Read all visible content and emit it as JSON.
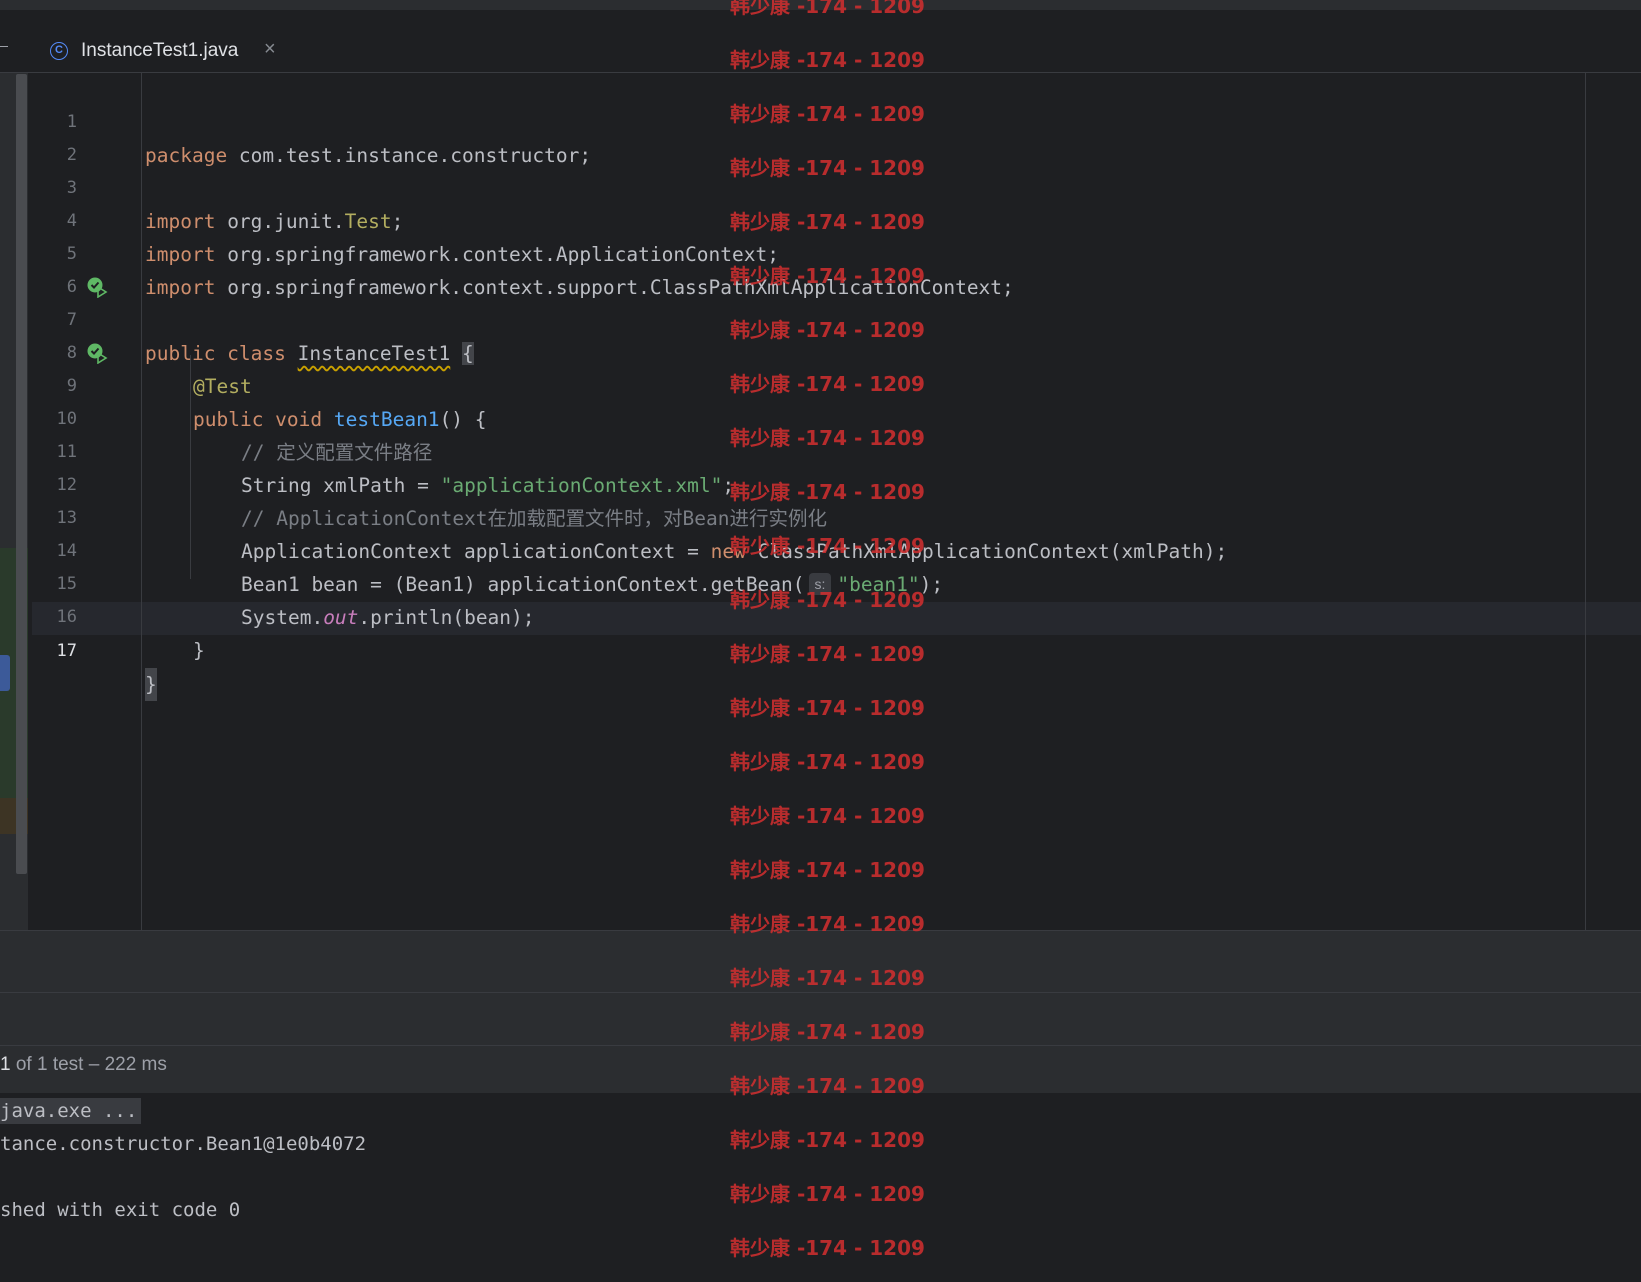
{
  "tab": {
    "icon": "java-class-icon",
    "icon_glyph": "C",
    "title": "InstanceTest1.java",
    "close_glyph": "×"
  },
  "editor": {
    "line_numbers": [
      "1",
      "2",
      "3",
      "4",
      "5",
      "6",
      "7",
      "8",
      "9",
      "10",
      "11",
      "12",
      "13",
      "14",
      "15",
      "16",
      "17"
    ],
    "current_line": "17",
    "code": {
      "l1": {
        "kw": "package",
        "rest": " com.test.instance.constructor;"
      },
      "l3": {
        "kw": "import",
        "pre": " org.junit.",
        "ann": "Test",
        "post": ";"
      },
      "l4": {
        "kw": "import",
        "rest": " org.springframework.context.ApplicationContext;"
      },
      "l5": {
        "kw": "import",
        "rest": " org.springframework.context.support.ClassPathXmlApplicationContext;"
      },
      "l7": {
        "kw": "public class",
        "name": "InstanceTest1",
        "brace": "{"
      },
      "l8": {
        "ann": "@Test"
      },
      "l9": {
        "kw": "public void",
        "fn": "testBean1",
        "rest": "() {"
      },
      "l10": {
        "cmt": "// 定义配置文件路径"
      },
      "l11": {
        "pre": "String xmlPath = ",
        "str": "\"applicationContext.xml\"",
        "post": ";"
      },
      "l12": {
        "cmt": "// ApplicationContext在加载配置文件时，对Bean进行实例化"
      },
      "l13": {
        "pre": "ApplicationContext applicationContext = ",
        "kw": "new",
        "post": " ClassPathXmlApplicationContext(xmlPath);"
      },
      "l14": {
        "pre": "Bean1 bean = (Bean1) applicationContext.getBean(",
        "hint": "s:",
        "str": "\"bean1\"",
        "post": ");"
      },
      "l15": {
        "pre": "System.",
        "stat": "out",
        "post": ".println(bean);"
      },
      "l16": {
        "rest": "}"
      },
      "l17": {
        "rest": "}"
      }
    },
    "gutter_icons": [
      "run-test-icon",
      "run-test-icon"
    ]
  },
  "run_panel": {
    "status_count": "1",
    "status_rest": " of 1 test – 222 ms",
    "console": {
      "cmd": "java.exe ...",
      "output": "tance.constructor.Bean1@1e0b4072",
      "exit": "shed with exit code 0"
    }
  },
  "watermark": {
    "text": "韩少康 -174 - 1209",
    "color": "#d32f2f"
  }
}
